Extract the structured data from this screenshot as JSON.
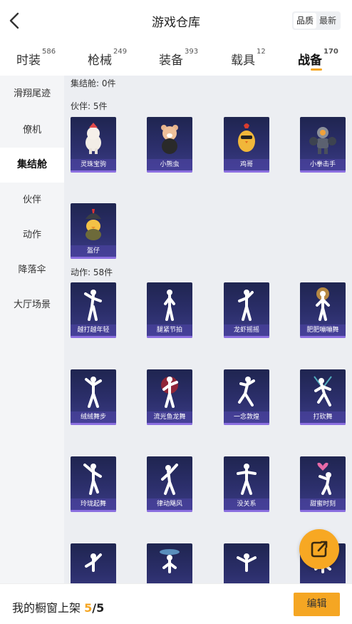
{
  "header": {
    "title": "游戏仓库",
    "sort_options": [
      "品质",
      "最新"
    ],
    "selected_sort": "品质"
  },
  "tabs": [
    {
      "label": "时装",
      "count": "586"
    },
    {
      "label": "枪械",
      "count": "249"
    },
    {
      "label": "装备",
      "count": "393"
    },
    {
      "label": "载具",
      "count": "12"
    },
    {
      "label": "战备",
      "count": "170",
      "active": true
    }
  ],
  "sidebar": {
    "items": [
      {
        "label": "滑翔尾迹"
      },
      {
        "label": "僚机"
      },
      {
        "label": "集结舱",
        "active": true
      },
      {
        "label": "伙伴"
      },
      {
        "label": "动作"
      },
      {
        "label": "降落伞"
      },
      {
        "label": "大厅场景"
      }
    ]
  },
  "sections": {
    "capsule_header": "集结舱: 0件",
    "partner_header": "伙伴: 5件",
    "action_header": "动作: 58件"
  },
  "partners": [
    {
      "name": "灵珠宝驹"
    },
    {
      "name": "小熊虫"
    },
    {
      "name": "鸡哥"
    },
    {
      "name": "小拳击手"
    },
    {
      "name": "盔仔"
    }
  ],
  "actions": [
    {
      "name": "越打越年轻"
    },
    {
      "name": "腿紧节拍"
    },
    {
      "name": "龙虾摇摇"
    },
    {
      "name": "肥肥嘣嘣舞"
    },
    {
      "name": "绒绒舞步"
    },
    {
      "name": "流光鱼龙舞"
    },
    {
      "name": "一念敦煌"
    },
    {
      "name": "打砍舞"
    },
    {
      "name": "玲珑起舞"
    },
    {
      "name": "律动飓风"
    },
    {
      "name": "没关系"
    },
    {
      "name": "甜蜜时刻"
    }
  ],
  "bottom": {
    "text": "我的橱窗上架",
    "num": "5",
    "den": "/5",
    "edit_label": "编辑"
  },
  "colors": {
    "accent": "#f5a623",
    "card_dark": "#1f2550",
    "card_light": "#3b3c86",
    "label_strip": "#8b6fe0"
  }
}
